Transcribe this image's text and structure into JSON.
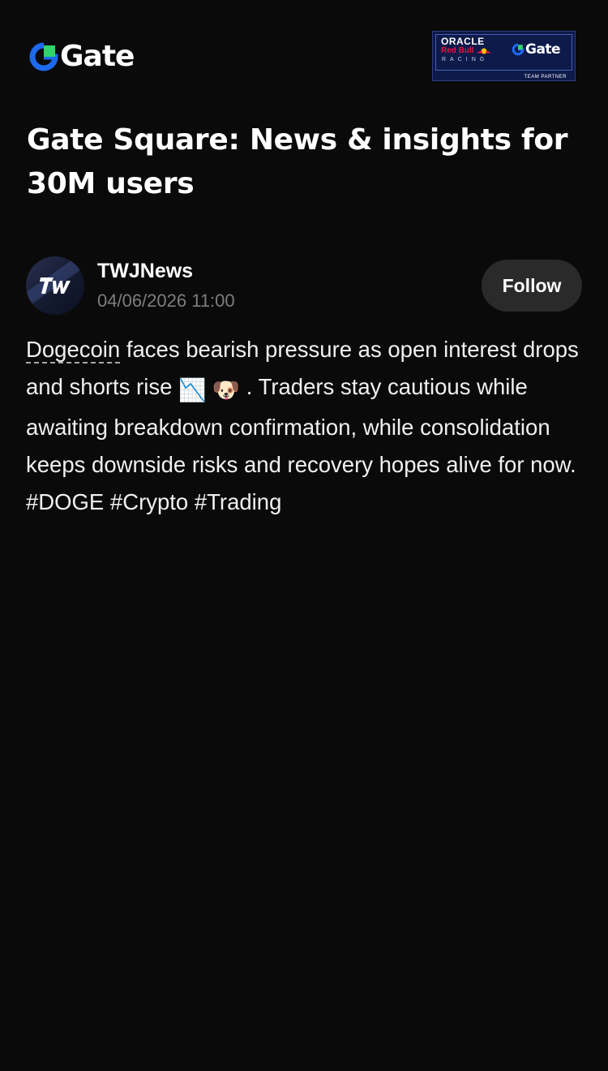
{
  "header": {
    "brand_name": "Gate",
    "partner_badge": {
      "oracle": "ORACLE",
      "red_bull": "Red Bull",
      "racing": "RACING",
      "gate": "Gate",
      "caption": "TEAM PARTNER"
    }
  },
  "page_title": "Gate Square: News & insights for 30M users",
  "post": {
    "author": {
      "name": "TWJNews",
      "avatar_initials": "TW"
    },
    "timestamp": "04/06/2026 11:00",
    "follow_label": "Follow",
    "body": {
      "coin_link": "Dogecoin",
      "text_1": " faces bearish pressure as open interest drops and shorts rise ",
      "emoji_1": "📉",
      "emoji_2": "🐶",
      "text_2": ". Traders stay cautious while awaiting breakdown confirmation, while consolidation keeps downside risks and recovery hopes alive for now. ",
      "hashtags": [
        "#DOGE",
        "#Crypto",
        "#Trading"
      ]
    }
  },
  "colors": {
    "background": "#0a0a0a",
    "brand_blue": "#1d6af0",
    "brand_green": "#2fd56a",
    "follow_button_bg": "#2a2a2a",
    "muted_text": "#7d7d7d"
  }
}
